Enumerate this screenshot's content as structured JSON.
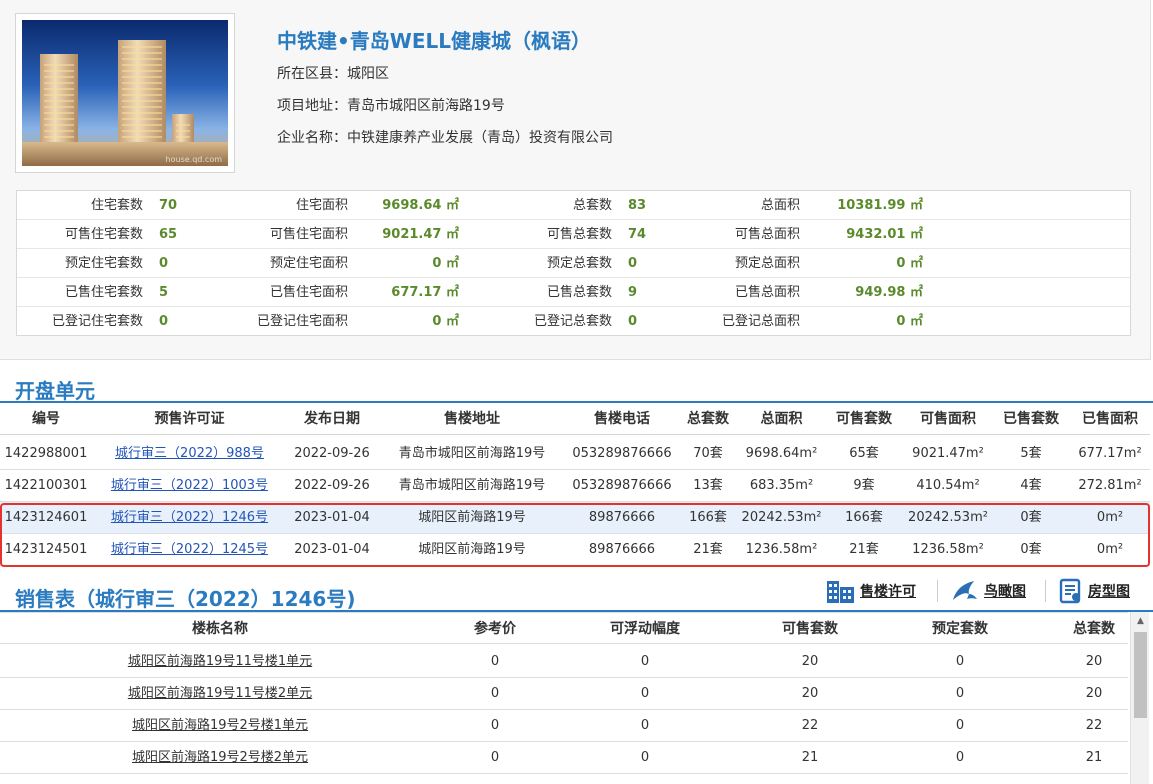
{
  "project": {
    "title": "中铁建•青岛WELL健康城（枫语）",
    "district_label": "所在区县：",
    "district": "城阳区",
    "address_label": "项目地址：",
    "address": "青岛市城阳区前海路19号",
    "company_label": "企业名称：",
    "company": "中铁建康养产业发展（青岛）投资有限公司",
    "photo_watermark": "house.qd.com"
  },
  "stats": [
    [
      {
        "label": "住宅套数",
        "value": "70"
      },
      {
        "label": "住宅面积",
        "value": "9698.64 ㎡"
      },
      {
        "label": "总套数",
        "value": "83"
      },
      {
        "label": "总面积",
        "value": "10381.99 ㎡"
      }
    ],
    [
      {
        "label": "可售住宅套数",
        "value": "65"
      },
      {
        "label": "可售住宅面积",
        "value": "9021.47 ㎡"
      },
      {
        "label": "可售总套数",
        "value": "74"
      },
      {
        "label": "可售总面积",
        "value": "9432.01 ㎡"
      }
    ],
    [
      {
        "label": "预定住宅套数",
        "value": "0"
      },
      {
        "label": "预定住宅面积",
        "value": "0 ㎡"
      },
      {
        "label": "预定总套数",
        "value": "0"
      },
      {
        "label": "预定总面积",
        "value": "0 ㎡"
      }
    ],
    [
      {
        "label": "已售住宅套数",
        "value": "5"
      },
      {
        "label": "已售住宅面积",
        "value": "677.17 ㎡"
      },
      {
        "label": "已售总套数",
        "value": "9"
      },
      {
        "label": "已售总面积",
        "value": "949.98 ㎡"
      }
    ],
    [
      {
        "label": "已登记住宅套数",
        "value": "0"
      },
      {
        "label": "已登记住宅面积",
        "value": "0 ㎡"
      },
      {
        "label": "已登记总套数",
        "value": "0"
      },
      {
        "label": "已登记总面积",
        "value": "0 ㎡"
      }
    ]
  ],
  "units": {
    "title": "开盘单元",
    "headers": [
      "编号",
      "预售许可证",
      "发布日期",
      "售楼地址",
      "售楼电话",
      "总套数",
      "总面积",
      "可售套数",
      "可售面积",
      "已售套数",
      "已售面积"
    ],
    "rows": [
      {
        "id": "1422988001",
        "permit": "城行审三（2022）988号",
        "date": "2022-09-26",
        "address": "青岛市城阳区前海路19号",
        "phone": "053289876666",
        "total": "70套",
        "area": "9698.64m²",
        "avail": "65套",
        "avail_area": "9021.47m²",
        "sold": "5套",
        "sold_area": "677.17m²",
        "highlight": false
      },
      {
        "id": "1422100301",
        "permit": "城行审三（2022）1003号",
        "date": "2022-09-26",
        "address": "青岛市城阳区前海路19号",
        "phone": "053289876666",
        "total": "13套",
        "area": "683.35m²",
        "avail": "9套",
        "avail_area": "410.54m²",
        "sold": "4套",
        "sold_area": "272.81m²",
        "highlight": false
      },
      {
        "id": "1423124601",
        "permit": "城行审三（2022）1246号",
        "date": "2023-01-04",
        "address": "城阳区前海路19号",
        "phone": "89876666",
        "total": "166套",
        "area": "20242.53m²",
        "avail": "166套",
        "avail_area": "20242.53m²",
        "sold": "0套",
        "sold_area": "0m²",
        "highlight": true
      },
      {
        "id": "1423124501",
        "permit": "城行审三（2022）1245号",
        "date": "2023-01-04",
        "address": "城阳区前海路19号",
        "phone": "89876666",
        "total": "21套",
        "area": "1236.58m²",
        "avail": "21套",
        "avail_area": "1236.58m²",
        "sold": "0套",
        "sold_area": "0m²",
        "highlight": false
      }
    ]
  },
  "sales": {
    "title": "销售表（城行审三（2022）1246号)",
    "tools": [
      {
        "label": "售楼许可",
        "icon": "building-icon"
      },
      {
        "label": "鸟瞰图",
        "icon": "bird-icon"
      },
      {
        "label": "房型图",
        "icon": "document-icon"
      }
    ],
    "headers": [
      "楼栋名称",
      "参考价",
      "可浮动幅度",
      "可售套数",
      "预定套数",
      "总套数"
    ],
    "rows": [
      {
        "name": "城阳区前海路19号11号楼1单元",
        "price": "0",
        "float": "0",
        "avail": "20",
        "reserved": "0",
        "total": "20"
      },
      {
        "name": "城阳区前海路19号11号楼2单元",
        "price": "0",
        "float": "0",
        "avail": "20",
        "reserved": "0",
        "total": "20"
      },
      {
        "name": "城阳区前海路19号2号楼1单元",
        "price": "0",
        "float": "0",
        "avail": "22",
        "reserved": "0",
        "total": "22"
      },
      {
        "name": "城阳区前海路19号2号楼2单元",
        "price": "0",
        "float": "0",
        "avail": "21",
        "reserved": "0",
        "total": "21"
      }
    ]
  }
}
